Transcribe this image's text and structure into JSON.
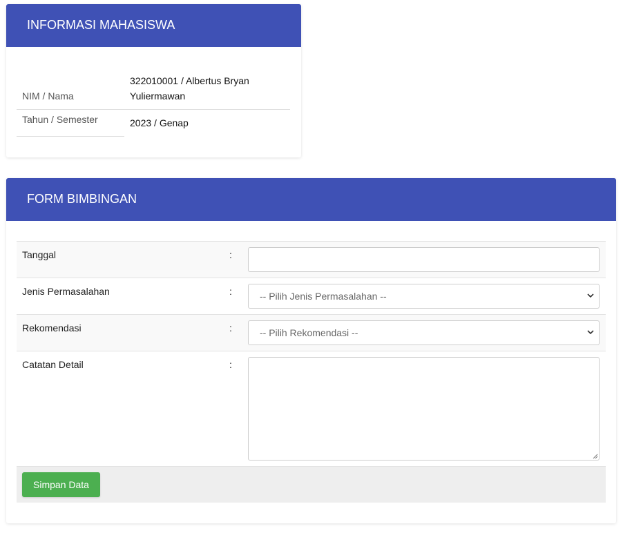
{
  "info": {
    "title": "INFORMASI MAHASISWA",
    "rows": [
      {
        "label": "NIM / Nama",
        "value_line1": "322010001 / Albertus Bryan",
        "value_line2": "Yuliermawan"
      },
      {
        "label": "Tahun / Semester",
        "value": "2023 / Genap"
      }
    ]
  },
  "form": {
    "title": "FORM BIMBINGAN",
    "colon": ":",
    "fields": {
      "tanggal": {
        "label": "Tanggal",
        "value": ""
      },
      "jenis": {
        "label": "Jenis Permasalahan",
        "selected": "-- Pilih Jenis Permasalahan --"
      },
      "rekomendasi": {
        "label": "Rekomendasi",
        "selected": "-- Pilih Rekomendasi --"
      },
      "catatan": {
        "label": "Catatan Detail",
        "value": ""
      }
    },
    "submit_label": "Simpan Data"
  },
  "colors": {
    "header_bg": "#3f51b5",
    "button_bg": "#4caf50"
  },
  "icons": [
    "chevron-down-icon",
    "resize-grip-icon"
  ]
}
